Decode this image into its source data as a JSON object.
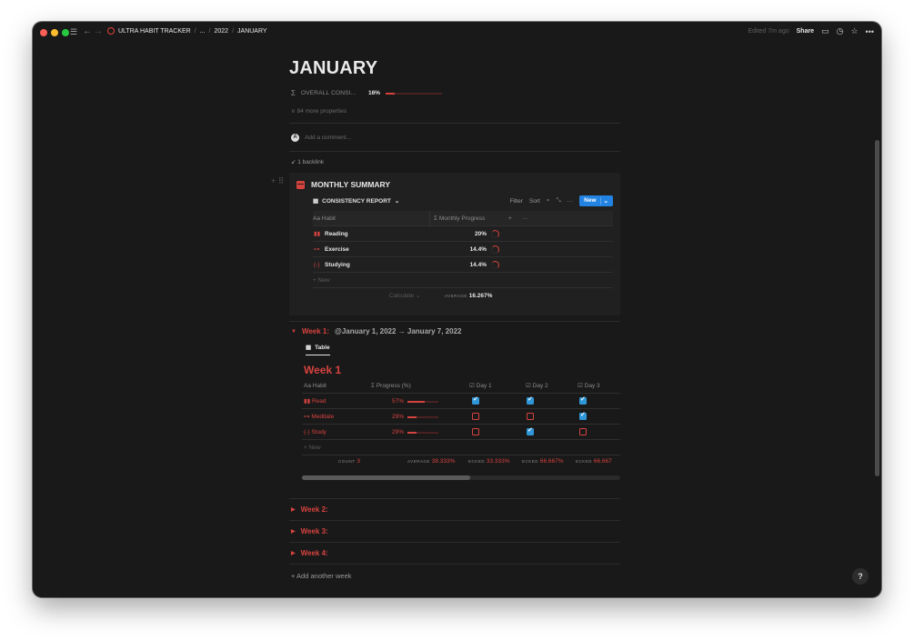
{
  "topbar": {
    "breadcrumbs": [
      "ULTRA HABIT TRACKER",
      "...",
      "2022",
      "JANUARY"
    ],
    "edited": "Edited 7m ago",
    "share": "Share"
  },
  "page": {
    "title": "JANUARY",
    "property_label": "OVERALL CONSI...",
    "property_value": "16%",
    "property_progress": 0.16,
    "more_properties": "84 more properties",
    "comment_placeholder": "Add a comment...",
    "backlinks": "1 backlink"
  },
  "summary": {
    "title": "MONTHLY SUMMARY",
    "view_name": "CONSISTENCY REPORT",
    "tools": {
      "filter": "Filter",
      "sort": "Sort",
      "new": "New"
    },
    "columns": [
      "Habit",
      "Monthly Progress"
    ],
    "rows": [
      {
        "name": "Reading",
        "value": "20%"
      },
      {
        "name": "Exercise",
        "value": "14.4%"
      },
      {
        "name": "Studying",
        "value": "14.4%"
      }
    ],
    "new_row": "+ New",
    "calculate": "Calculate",
    "average_label": "AVERAGE",
    "average_value": "16.267%"
  },
  "week1": {
    "header": "Week 1:",
    "dates": "@January 1, 2022 → January 7, 2022",
    "tab": "Table",
    "title": "Week 1",
    "columns": [
      "Habit",
      "Progress (%)",
      "Day 1",
      "Day 2",
      "Day 3"
    ],
    "rows": [
      {
        "name": "Read",
        "progress": "57%",
        "progress_frac": 0.57,
        "days": [
          true,
          true,
          true
        ]
      },
      {
        "name": "Meditate",
        "progress": "29%",
        "progress_frac": 0.29,
        "days": [
          false,
          false,
          true
        ]
      },
      {
        "name": "Study",
        "progress": "29%",
        "progress_frac": 0.29,
        "days": [
          false,
          true,
          false
        ]
      }
    ],
    "new_row": "+ New",
    "count_label": "COUNT",
    "count_value": "3",
    "avg_label": "AVERAGE",
    "avg_value": "38.333%",
    "checked_1_label": "ECKED",
    "checked_1_value": "33.333%",
    "checked_2_label": "ECKED",
    "checked_2_value": "66.667%",
    "checked_3_label": "ECKED",
    "checked_3_value": "66.667"
  },
  "weeks": [
    "Week 2:",
    "Week 3:",
    "Week 4:"
  ],
  "add_week": "+ Add another week",
  "help": "?"
}
